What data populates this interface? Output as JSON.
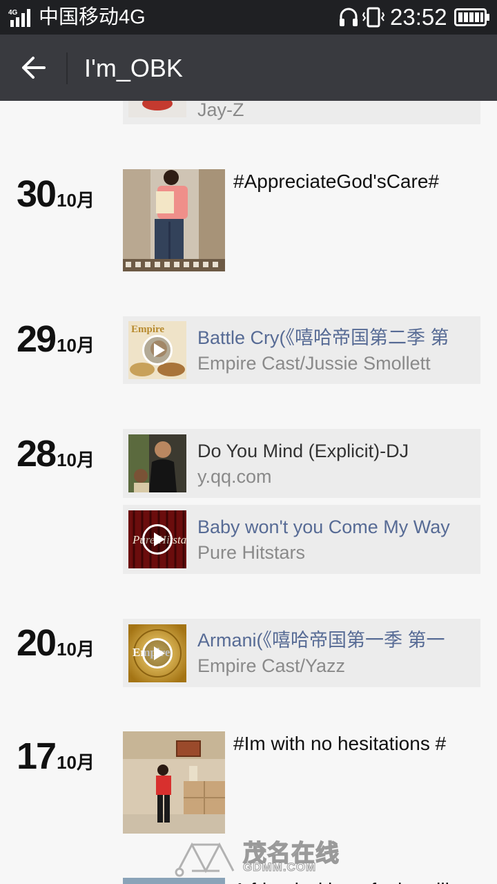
{
  "status_bar": {
    "network_badge": "4G",
    "carrier": "中国移动4G",
    "time": "23:52",
    "icons": [
      "signal-icon",
      "headset-icon",
      "vibrate-icon",
      "battery-icon"
    ]
  },
  "title_bar": {
    "back_icon": "arrow-left-icon",
    "title": "I'm_OBK"
  },
  "feed": {
    "top_partial": {
      "subtitle": "Jay-Z"
    },
    "entries": [
      {
        "day": "30",
        "month": "10月",
        "type": "photo",
        "text": "#AppreciateGod'sCare#"
      },
      {
        "day": "29",
        "month": "10月",
        "type": "music",
        "title": "Battle Cry(《嘻哈帝国第二季 第",
        "subtitle": "Empire Cast/Jussie Smollett",
        "thumb_label": "Empire"
      },
      {
        "day": "28",
        "month": "10月",
        "type": "links",
        "items": [
          {
            "title": "Do You Mind (Explicit)-DJ",
            "subtitle": "y.qq.com"
          },
          {
            "title": "Baby won't you Come My Way",
            "subtitle": "Pure Hitstars",
            "thumb_label": "Pure Hitstars"
          }
        ]
      },
      {
        "day": "20",
        "month": "10月",
        "type": "music",
        "title": "Armani(《嘻哈帝国第一季 第一",
        "subtitle": "Empire Cast/Yazz",
        "thumb_label": "Empire"
      },
      {
        "day": "17",
        "month": "10月",
        "type": "photo",
        "text": "#Im with no hesitations #"
      }
    ],
    "bottom_partial": {
      "text": "A friend without faults will"
    }
  },
  "watermark": {
    "text": "茂名在线",
    "sub": "GDMM.COM"
  },
  "colors": {
    "link": "#576b95",
    "title_bar": "#393a3f",
    "status_bar": "#1f2023",
    "card_bg": "#ececec"
  }
}
